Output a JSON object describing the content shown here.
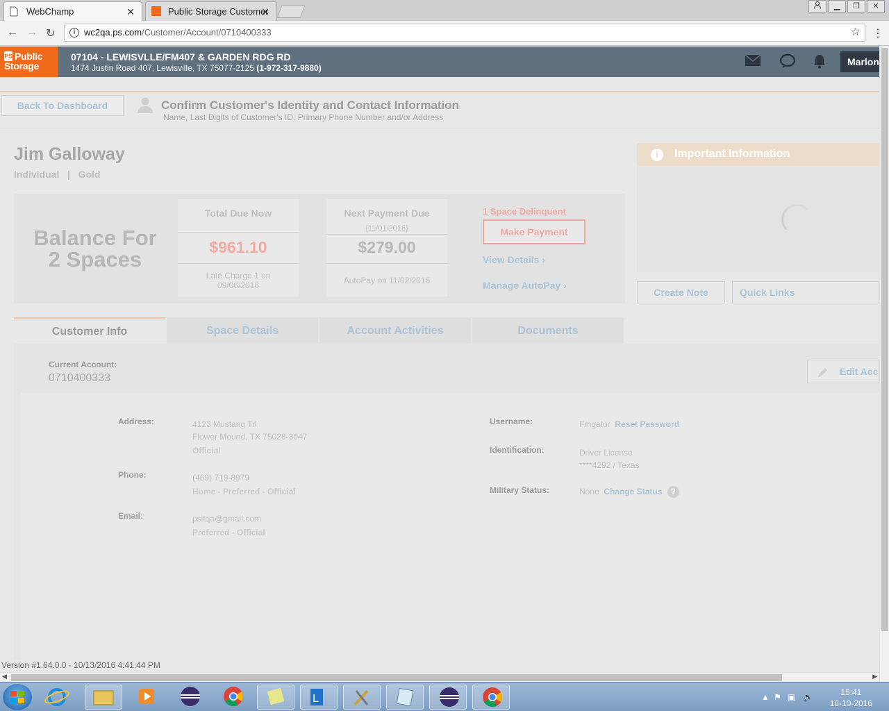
{
  "browser": {
    "tabs": [
      {
        "title": "WebChamp"
      },
      {
        "title": "Public Storage Customer"
      }
    ],
    "url_host": "wc2qa.ps.com",
    "url_path": "/Customer/Account/0710400333"
  },
  "header": {
    "logo_line1": "Public",
    "logo_line2": "Storage",
    "store_title": "07104 - LEWISVLLE/FM407 & GARDEN RDG RD",
    "store_address": "1474 Justin Road 407, Lewisville, TX 75077-2125",
    "store_phone": "(1-972-317-9880)",
    "user_label": "Marlon"
  },
  "page": {
    "back_button": "Back To Dashboard",
    "confirm_title": "Confirm Customer's Identity and Contact Information",
    "confirm_subtitle": "Name, Last Digits of Customer's ID, Primary Phone Number and/or Address",
    "customer_name": "Jim Galloway",
    "customer_type": "Individual",
    "customer_separator": "|",
    "customer_tier": "Gold"
  },
  "balance": {
    "label_line1": "Balance For",
    "label_line2": "2 Spaces",
    "total_due_title": "Total Due Now",
    "total_due_amount": "$961.10",
    "total_due_note_line1": "Late Charge 1 on",
    "total_due_note_line2": "09/06/2016",
    "next_payment_title": "Next Payment Due",
    "next_payment_date": "{11/01/2016}",
    "next_payment_amount": "$279.00",
    "next_payment_note": "AutoPay on 11/02/2016",
    "delinquent_text": "1 Space Delinquent",
    "make_payment": "Make Payment",
    "view_details": "View Details",
    "manage_autopay": "Manage AutoPay",
    "colors": {
      "amount_due": "#f3a9a2",
      "amount_next": "#b6b6b6"
    }
  },
  "important": {
    "title": "Important Information",
    "create_note": "Create Note",
    "quick_links": "Quick Links"
  },
  "tabs": [
    {
      "label": "Customer Info",
      "active": true
    },
    {
      "label": "Space Details",
      "active": false
    },
    {
      "label": "Account Activities",
      "active": false
    },
    {
      "label": "Documents",
      "active": false
    }
  ],
  "customer_info": {
    "current_account_label": "Current Account:",
    "current_account_value": "0710400333",
    "edit_button": "Edit Account",
    "address_label": "Address:",
    "address_line1": "4123 Mustang Trl",
    "address_line2": "Flower Mound, TX 75028-3047",
    "address_tag": "Official",
    "phone_label": "Phone:",
    "phone_value": "(469) 719-8979",
    "phone_tag": "Home - Preferred - Official",
    "email_label": "Email:",
    "email_value": "psitqa@gmail.com",
    "email_tag": "Preferred - Official",
    "username_label": "Username:",
    "username_value": "Fmgator",
    "reset_password": "Reset Password",
    "identification_label": "Identification:",
    "identification_line1": "Driver License",
    "identification_line2": "****4292 / Texas",
    "military_label": "Military Status:",
    "military_value": "None",
    "change_status": "Change Status",
    "help_mark": "?"
  },
  "footer": {
    "version": "Version #1.64.0.0 - 10/13/2016 4:41:44 PM"
  },
  "taskbar": {
    "time": "15:41",
    "date": "18-10-2016"
  }
}
